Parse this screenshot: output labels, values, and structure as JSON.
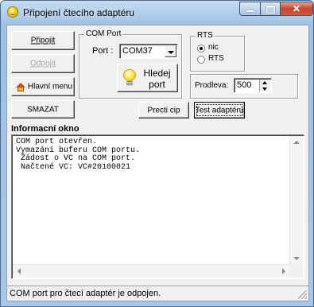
{
  "window": {
    "title": "Připojení čtecího adaptéru",
    "close_glyph": "✕"
  },
  "connection": {
    "connect_label": "Připojit",
    "disconnect_label": "Odpojit",
    "main_menu_label": "Hlavní menu"
  },
  "com_port": {
    "group_title": "COM Port",
    "port_label": "Port :",
    "selected_port": "COM37",
    "search_label_line1": "Hledej",
    "search_label_line2": "port"
  },
  "rts": {
    "group_title": "RTS",
    "options": [
      "nic",
      "RTS"
    ],
    "selected": "nic"
  },
  "delay": {
    "label": "Prodleva:",
    "value": "500"
  },
  "actions": {
    "clear_label": "SMAZAT",
    "read_chip_label": "Precti cip",
    "test_adapter_label": "Test adaptéru"
  },
  "info": {
    "title": "Informacní okno",
    "lines": [
      "COM port otevřen.",
      "Vymazání buferu COM portu.",
      " Žádost o VC na COM port.",
      " Načtené VC: VC#20100021"
    ]
  },
  "status": {
    "text": "COM port pro čtecí adaptér je odpojen."
  },
  "colors": {
    "window_frame": "#9cbfe2",
    "client_bg": "#f0f0f0",
    "close_button": "#c7452d"
  },
  "icons": {
    "app": "smiley-icon",
    "search_port": "lightbulb-icon",
    "main_menu": "home-icon"
  }
}
